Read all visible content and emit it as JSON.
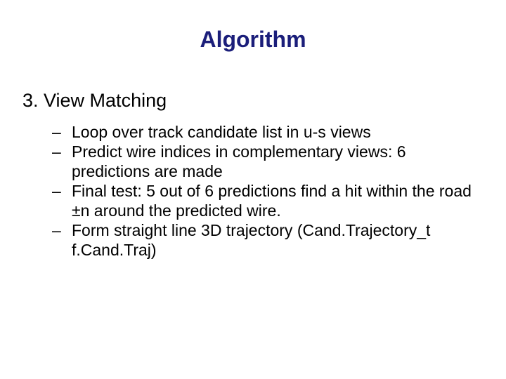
{
  "title": "Algorithm",
  "section": "3. View Matching",
  "bullets": [
    "Loop over track candidate list in u-s views",
    "Predict wire indices in complementary views: 6 predictions are made",
    "Final test: 5 out of 6 predictions find a hit within the road ±n around the predicted wire.",
    "Form straight line 3D trajectory (Cand.Trajectory_t f.Cand.Traj)"
  ]
}
